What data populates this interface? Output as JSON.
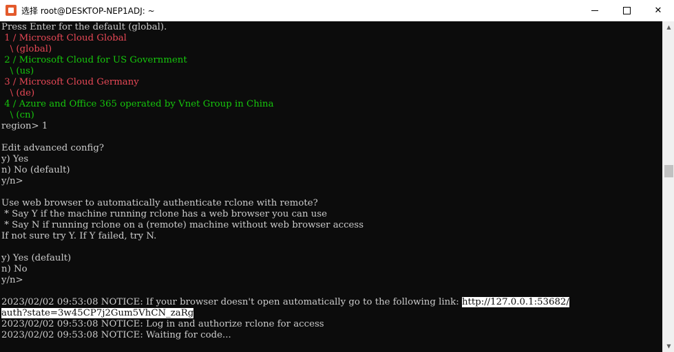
{
  "window": {
    "title": "选择 root@DESKTOP-NEP1ADJ: ~",
    "buttons": {
      "minimize": "minimize-icon",
      "maximize": "maximize-icon",
      "close": "close-icon"
    }
  },
  "terminal": {
    "lines": [
      "Press Enter for the default (global).",
      " 1 / Microsoft Cloud Global",
      "   \\ (global)",
      " 2 / Microsoft Cloud for US Government",
      "   \\ (us)",
      " 3 / Microsoft Cloud Germany",
      "   \\ (de)",
      " 4 / Azure and Office 365 operated by Vnet Group in China",
      "   \\ (cn)",
      "region> 1",
      "",
      "Edit advanced config?",
      "y) Yes",
      "n) No (default)",
      "y/n>",
      "",
      "Use web browser to automatically authenticate rclone with remote?",
      " * Say Y if the machine running rclone has a web browser you can use",
      " * Say N if running rclone on a (remote) machine without web browser access",
      "If not sure try Y. If Y failed, try N.",
      "",
      "y) Yes (default)",
      "n) No",
      "y/n>",
      "",
      "2023/02/02 09:53:08 NOTICE: If your browser doesn't open automatically go to the following link: ",
      "2023/02/02 09:53:08 NOTICE: Log in and authorize rclone for access",
      "2023/02/02 09:53:08 NOTICE: Waiting for code..."
    ],
    "link_part1": "http://127.0.0.1:53682/",
    "link_part2": "auth?state=3w45CP7j2Gum5VhCN_zaRg"
  },
  "colors": {
    "background": "#0c0c0c",
    "text": "#cccccc",
    "red": "#e74856",
    "green": "#16c60c",
    "selection": "#ffffff"
  }
}
